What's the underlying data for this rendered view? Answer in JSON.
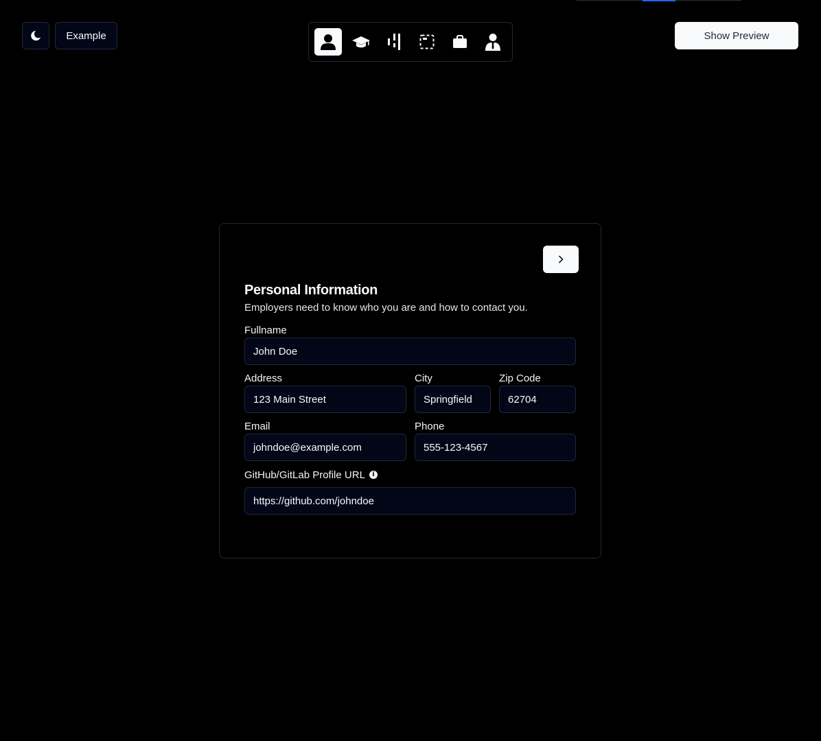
{
  "toolbar": {
    "theme_icon": "moon-icon",
    "example_label": "Example",
    "preview_label": "Show Preview"
  },
  "steps": [
    {
      "icon": "user-icon",
      "active": true
    },
    {
      "icon": "graduation-cap-icon",
      "active": false
    },
    {
      "icon": "sliders-icon",
      "active": false
    },
    {
      "icon": "dashed-square-icon",
      "active": false
    },
    {
      "icon": "briefcase-icon",
      "active": false
    },
    {
      "icon": "user-tie-icon",
      "active": false
    }
  ],
  "form": {
    "title": "Personal Information",
    "subtitle": "Employers need to know who you are and how to contact you.",
    "fields": {
      "fullname": {
        "label": "Fullname",
        "value": "John Doe"
      },
      "address": {
        "label": "Address",
        "value": "123 Main Street"
      },
      "city": {
        "label": "City",
        "value": "Springfield"
      },
      "zip": {
        "label": "Zip Code",
        "value": "62704"
      },
      "email": {
        "label": "Email",
        "value": "johndoe@example.com"
      },
      "phone": {
        "label": "Phone",
        "value": "555-123-4567"
      },
      "profile_url": {
        "label": "GitHub/GitLab Profile URL",
        "value": "https://github.com/johndoe"
      }
    }
  },
  "colors": {
    "background": "#000000",
    "accent": "#2563eb",
    "input_bg": "#020617",
    "border": "#1e293b",
    "button_light": "#f8fafc"
  }
}
